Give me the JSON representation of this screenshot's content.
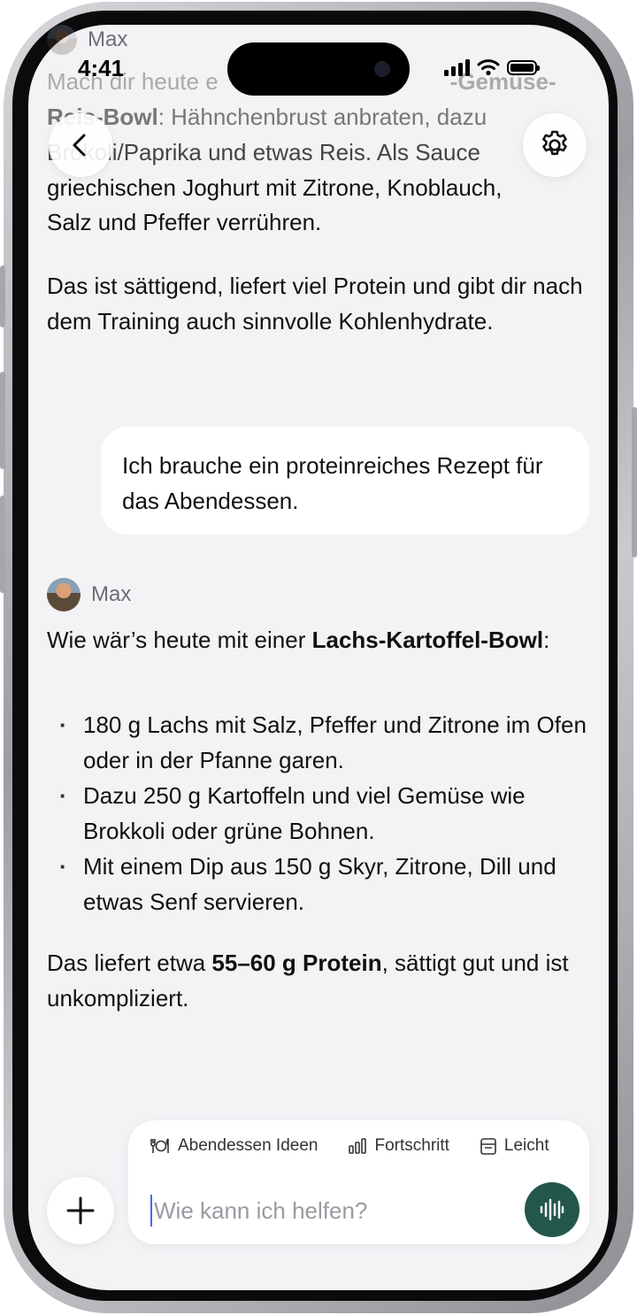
{
  "status_bar": {
    "time": "4:41"
  },
  "previous_message": {
    "sender": "Max",
    "line1_start": "Mach dir heute e",
    "line1_bold": "-Gemüse-",
    "line2_bold": "Reis-Bowl",
    "line2_rest": ": Hähnchenbrust anbraten, dazu",
    "line3_start": "Bro",
    "line3_rest": "koli/Paprika und etwas Reis. Als Sauce",
    "line4": "griechischen Joghurt mit Zitrone, Knoblauch,",
    "line5": "Salz und Pfeffer verrühren.",
    "para2": "Das ist sättigend, liefert viel Protein und gibt dir nach dem Training auch sinnvolle Kohlenhydrate."
  },
  "user_message": {
    "text": "Ich brauche ein proteinreiches Rezept für das Abendessen."
  },
  "assistant_message": {
    "sender": "Max",
    "intro_start": "Wie wär’s heute mit einer ",
    "intro_bold": "Lachs-Kartoffel-Bowl",
    "intro_end": ":",
    "bullets": [
      "180 g Lachs mit Salz, Pfeffer und Zitrone im Ofen oder in der Pfanne garen.",
      "Dazu 250 g Kartoffeln und viel Gemüse wie Brokkoli oder grüne Bohnen.",
      "Mit einem Dip aus 150 g Skyr, Zitrone, Dill und etwas Senf servieren."
    ],
    "outro_start": "Das liefert etwa ",
    "outro_bold": "55–60 g Protein",
    "outro_end": ", sättigt gut und ist unkompliziert."
  },
  "composer": {
    "placeholder": "Wie kann ich helfen?",
    "chips": [
      {
        "label": "Abendessen Ideen",
        "icon": "fork-knife-icon"
      },
      {
        "label": "Fortschritt",
        "icon": "bar-chart-icon"
      },
      {
        "label": "Leicht",
        "icon": "calendar-icon"
      }
    ]
  },
  "colors": {
    "mic_button": "#24574b",
    "background": "#f3f3f6",
    "cursor": "#3b6cff"
  }
}
